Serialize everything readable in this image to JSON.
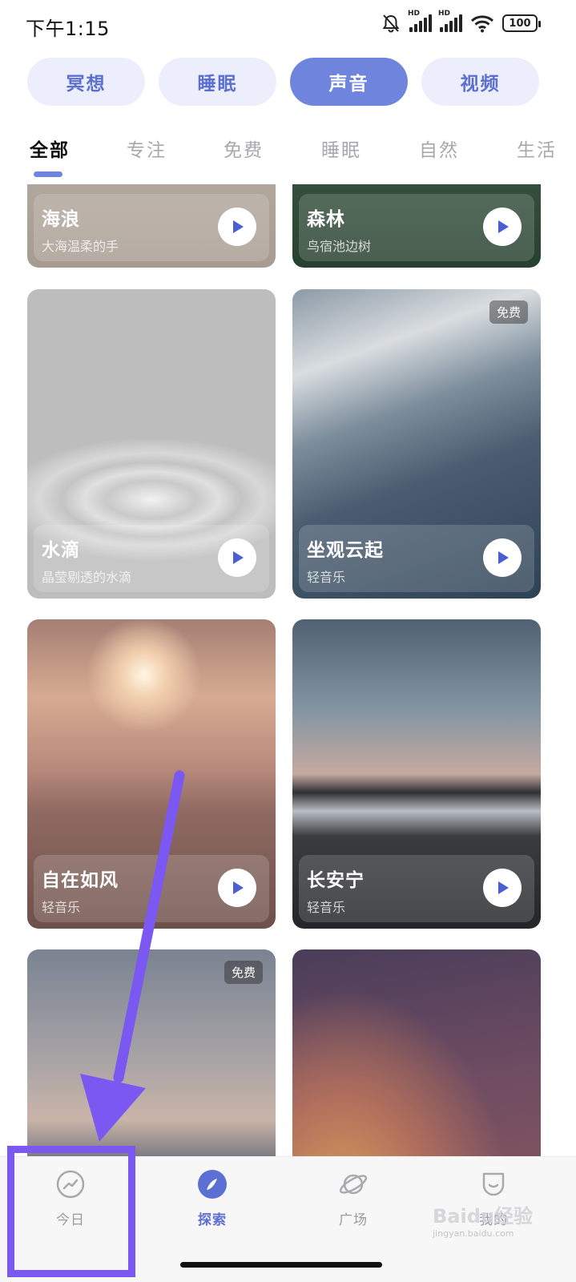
{
  "status_bar": {
    "time": "下午1:15",
    "battery": "100",
    "network_label": "HD"
  },
  "category_pills": [
    {
      "label": "冥想"
    },
    {
      "label": "睡眠"
    },
    {
      "label": "声音",
      "active": true
    },
    {
      "label": "视频"
    }
  ],
  "sub_tabs": [
    {
      "label": "全部",
      "active": true
    },
    {
      "label": "专注"
    },
    {
      "label": "免费"
    },
    {
      "label": "睡眠"
    },
    {
      "label": "自然"
    },
    {
      "label": "生活"
    }
  ],
  "cards": [
    {
      "title": "海浪",
      "subtitle": "大海温柔的手",
      "free": false
    },
    {
      "title": "森林",
      "subtitle": "鸟宿池边树",
      "free": false
    },
    {
      "title": "水滴",
      "subtitle": "晶莹剔透的水滴",
      "free": false
    },
    {
      "title": "坐观云起",
      "subtitle": "轻音乐",
      "free": true
    },
    {
      "title": "自在如风",
      "subtitle": "轻音乐",
      "free": false
    },
    {
      "title": "长安宁",
      "subtitle": "轻音乐",
      "free": false
    },
    {
      "title": "",
      "subtitle": "",
      "free": true
    },
    {
      "title": "",
      "subtitle": "",
      "free": false
    }
  ],
  "free_badge_label": "免费",
  "bottom_nav": [
    {
      "label": "今日",
      "icon": "trend-icon"
    },
    {
      "label": "探索",
      "icon": "compass-icon",
      "active": true
    },
    {
      "label": "广场",
      "icon": "planet-icon"
    },
    {
      "label": "我的",
      "icon": "profile-icon"
    }
  ],
  "watermark": {
    "text": "Baidu经验",
    "url": "jingyan.baidu.com"
  },
  "colors": {
    "accent": "#6f85dd",
    "pill_bg": "#eceefb",
    "annotation": "#7b58f2"
  }
}
